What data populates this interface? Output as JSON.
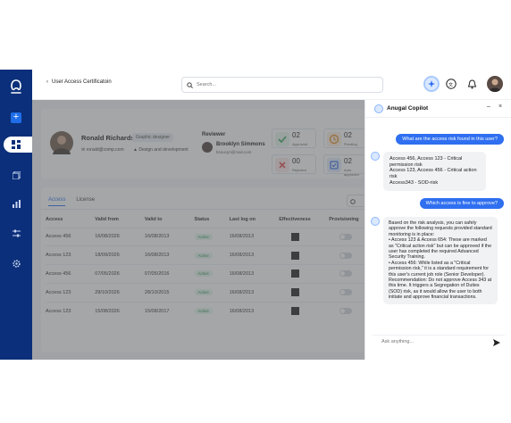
{
  "header": {
    "back_label": "User Access Certificatoin",
    "search_placeholder": "Search..."
  },
  "profile": {
    "name": "Ronald Richards",
    "role": "Graphic designer",
    "email": "ronald@comp.com",
    "department": "Design and development",
    "reviewer_label": "Reviewer",
    "reviewer_name": "Brooklyn Simmons",
    "reviewer_email": "bsoucyn@mail.com"
  },
  "stats": [
    {
      "value": "02",
      "label": "Approved",
      "color": "#2ea25a"
    },
    {
      "value": "02",
      "label": "Pending",
      "color": "#e78a1e"
    },
    {
      "value": "00",
      "label": "Rejected",
      "color": "#e04545"
    },
    {
      "value": "02",
      "label": "Auto approved",
      "color": "#2f6ff0"
    }
  ],
  "tabs": [
    "Access",
    "License"
  ],
  "table": {
    "headers": [
      "Access",
      "Valid from",
      "Valid to",
      "Status",
      "Last log on",
      "Effectiveness",
      "Provisioning"
    ],
    "rows": [
      {
        "access": "Access 456",
        "from": "16/08/2026",
        "to": "16/08/2013",
        "status": "Active",
        "last": "16/08/2013"
      },
      {
        "access": "Access 123",
        "from": "18/09/2026",
        "to": "16/08/2013",
        "status": "Active",
        "last": "16/08/2013"
      },
      {
        "access": "Access 456",
        "from": "07/05/2026",
        "to": "07/05/2016",
        "status": "Active",
        "last": "16/08/2013"
      },
      {
        "access": "Access 123",
        "from": "28/10/2026",
        "to": "28/10/2015",
        "status": "Active",
        "last": "16/08/2013"
      },
      {
        "access": "Access 123",
        "from": "15/08/2026",
        "to": "15/08/2017",
        "status": "Active",
        "last": "16/08/2013"
      }
    ]
  },
  "copilot": {
    "title": "Anugal Copilot",
    "minimize": "–",
    "close": "×",
    "q1": "What are the access risk found in this user?",
    "a1": "Access 456, Access 123 - Critical permission risk\nAccess 123, Access 456 - Critical action risk\nAccess343 - SOD-risk",
    "q2": "Which access is fine to approve?",
    "a2": "Based on the risk analysis, you can safely approve the following requests provided standard monitoring is in place:\n• Access 123 & Access 654: These are marked as \"Critical action risk\" but can be approved if the user has completed the required Advanced Security Training.\n• Access 456: While listed as a \"Critical permission risk,\" it is a standard requirement for this user's current job role (Senior Developer).\nRecommendation: Do not approve Access 343 at this time. It triggers a Segregation of Duties (SOD) risk, as it would allow the user to both initiate and approve financial transactions.",
    "input_placeholder": "Ask anything..."
  }
}
